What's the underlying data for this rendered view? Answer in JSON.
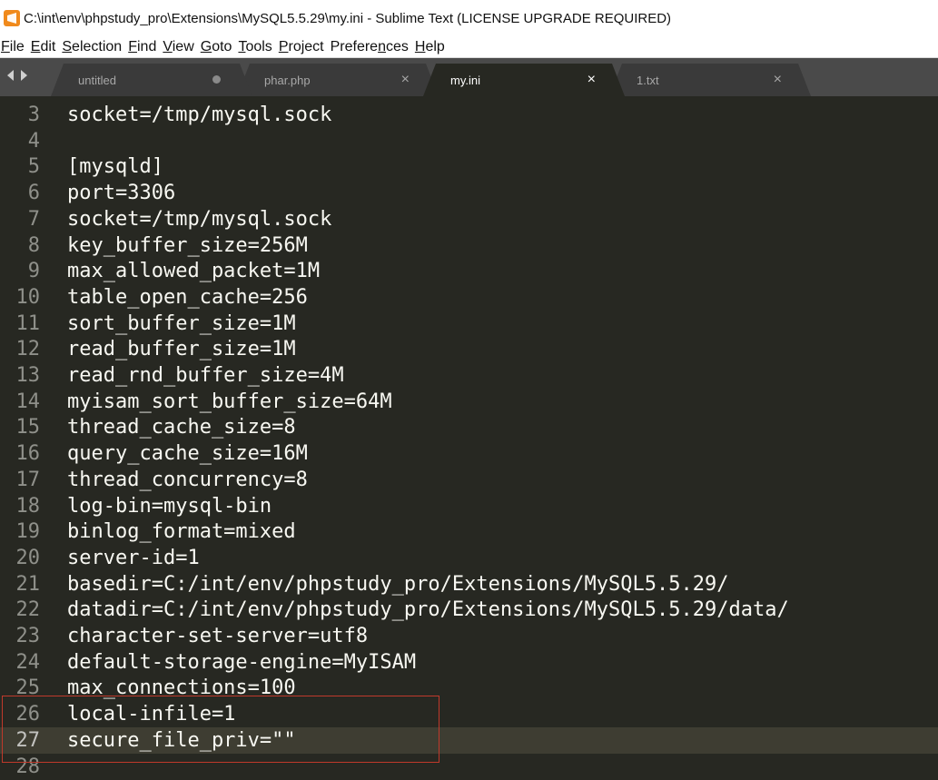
{
  "window": {
    "title": "C:\\int\\env\\phpstudy_pro\\Extensions\\MySQL5.5.29\\my.ini - Sublime Text (LICENSE UPGRADE REQUIRED)",
    "icon": "sublime-text-icon"
  },
  "menu": [
    {
      "label": "File",
      "u": "F",
      "rest": "ile"
    },
    {
      "label": "Edit",
      "u": "E",
      "rest": "dit"
    },
    {
      "label": "Selection",
      "u": "S",
      "rest": "election"
    },
    {
      "label": "Find",
      "u": "F",
      "rest": "ind",
      "after": true
    },
    {
      "label": "View",
      "u": "V",
      "rest": "iew"
    },
    {
      "label": "Goto",
      "u": "G",
      "rest": "oto"
    },
    {
      "label": "Tools",
      "u": "T",
      "rest": "ools"
    },
    {
      "label": "Project",
      "u": "P",
      "rest": "roject"
    },
    {
      "label": "Preferences",
      "u": "n",
      "rest": "Prefere|ces"
    },
    {
      "label": "Help",
      "u": "H",
      "rest": "elp"
    }
  ],
  "tabs": [
    {
      "label": "untitled",
      "modified": true,
      "active": false
    },
    {
      "label": "phar.php",
      "modified": false,
      "active": false
    },
    {
      "label": "my.ini",
      "modified": false,
      "active": true
    },
    {
      "label": "1.txt",
      "modified": false,
      "active": false
    }
  ],
  "tab_close_glyph": "×",
  "editor": {
    "lines": [
      {
        "num": "3",
        "text": "socket=/tmp/mysql.sock"
      },
      {
        "num": "4",
        "text": ""
      },
      {
        "num": "5",
        "text": "[mysqld]"
      },
      {
        "num": "6",
        "text": "port=3306"
      },
      {
        "num": "7",
        "text": "socket=/tmp/mysql.sock"
      },
      {
        "num": "8",
        "text": "key_buffer_size=256M"
      },
      {
        "num": "9",
        "text": "max_allowed_packet=1M"
      },
      {
        "num": "10",
        "text": "table_open_cache=256"
      },
      {
        "num": "11",
        "text": "sort_buffer_size=1M"
      },
      {
        "num": "12",
        "text": "read_buffer_size=1M"
      },
      {
        "num": "13",
        "text": "read_rnd_buffer_size=4M"
      },
      {
        "num": "14",
        "text": "myisam_sort_buffer_size=64M"
      },
      {
        "num": "15",
        "text": "thread_cache_size=8"
      },
      {
        "num": "16",
        "text": "query_cache_size=16M"
      },
      {
        "num": "17",
        "text": "thread_concurrency=8"
      },
      {
        "num": "18",
        "text": "log-bin=mysql-bin"
      },
      {
        "num": "19",
        "text": "binlog_format=mixed"
      },
      {
        "num": "20",
        "text": "server-id=1"
      },
      {
        "num": "21",
        "text": "basedir=C:/int/env/phpstudy_pro/Extensions/MySQL5.5.29/"
      },
      {
        "num": "22",
        "text": "datadir=C:/int/env/phpstudy_pro/Extensions/MySQL5.5.29/data/"
      },
      {
        "num": "23",
        "text": "character-set-server=utf8"
      },
      {
        "num": "24",
        "text": "default-storage-engine=MyISAM"
      },
      {
        "num": "25",
        "text": "max_connections=100"
      },
      {
        "num": "26",
        "text": "local-infile=1"
      },
      {
        "num": "27",
        "text": "secure_file_priv=\"\"",
        "current": true
      },
      {
        "num": "28",
        "text": ""
      }
    ]
  },
  "colors": {
    "editor_bg": "#272822",
    "text": "#f8f8f2",
    "gutter_text": "#8f908a",
    "current_line": "#3e3d32",
    "tabbar_bg": "#4a4a4a",
    "tab_bg": "#3a3a3a",
    "active_tab_bg": "#272822",
    "annotation_box": "#c0392b"
  }
}
